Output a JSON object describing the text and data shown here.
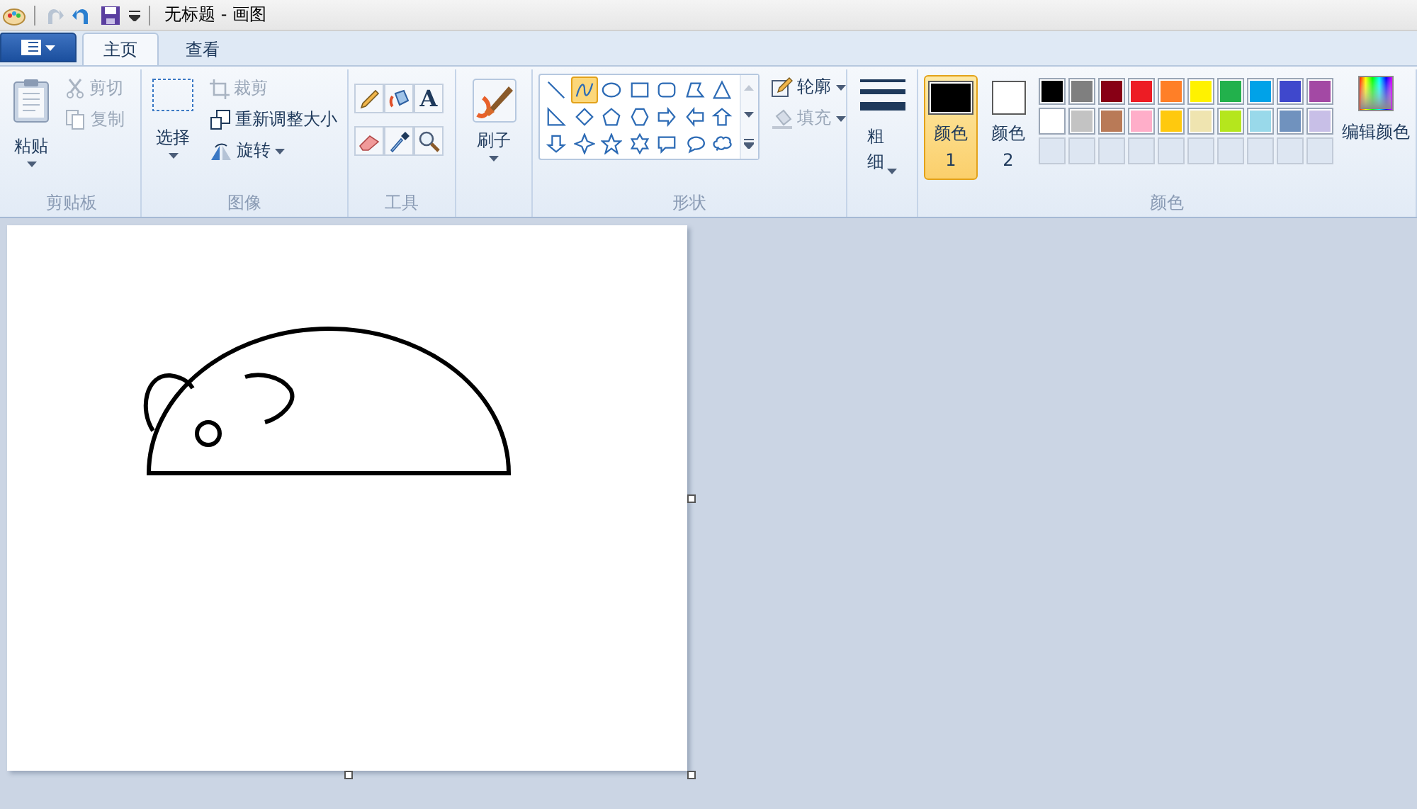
{
  "window": {
    "title": "无标题 - 画图"
  },
  "tabs": [
    {
      "label": "主页",
      "selected": true
    },
    {
      "label": "查看",
      "selected": false
    }
  ],
  "clipboard": {
    "title": "剪贴板",
    "paste": "粘贴",
    "items": [
      {
        "kind": "cut",
        "label": "剪切",
        "disabled": true
      },
      {
        "kind": "copy",
        "label": "复制",
        "disabled": true
      }
    ]
  },
  "image": {
    "title": "图像",
    "select": "选择",
    "items": [
      {
        "kind": "crop",
        "label": "裁剪",
        "disabled": true
      },
      {
        "kind": "resize",
        "label": "重新调整大小",
        "disabled": false
      },
      {
        "kind": "rotate",
        "label": "旋转",
        "disabled": false
      }
    ]
  },
  "tools": {
    "title": "工具",
    "text_tool": "A"
  },
  "brushes": {
    "label": "刷子"
  },
  "shapes": {
    "title": "形状",
    "outline": {
      "label": "轮廓",
      "disabled": false
    },
    "fill": {
      "label": "填充",
      "disabled": true
    },
    "items": [
      {
        "kind": "line",
        "selected": false
      },
      {
        "kind": "curve",
        "selected": true
      },
      {
        "kind": "oval",
        "selected": false
      },
      {
        "kind": "rect",
        "selected": false
      },
      {
        "kind": "roundrect",
        "selected": false
      },
      {
        "kind": "polygon",
        "selected": false
      },
      {
        "kind": "triangle",
        "selected": false
      },
      {
        "kind": "right-triangle",
        "selected": false
      },
      {
        "kind": "diamond",
        "selected": false
      },
      {
        "kind": "pentagon",
        "selected": false
      },
      {
        "kind": "hexagon",
        "selected": false
      },
      {
        "kind": "arrow-right",
        "selected": false
      },
      {
        "kind": "arrow-left",
        "selected": false
      },
      {
        "kind": "arrow-up",
        "selected": false
      },
      {
        "kind": "arrow-down",
        "selected": false
      },
      {
        "kind": "star4",
        "selected": false
      },
      {
        "kind": "star5",
        "selected": false
      },
      {
        "kind": "star6",
        "selected": false
      },
      {
        "kind": "callout-rect",
        "selected": false
      },
      {
        "kind": "callout-oval",
        "selected": false
      },
      {
        "kind": "callout-cloud",
        "selected": false
      }
    ]
  },
  "size": {
    "label": "粗细"
  },
  "colors": {
    "title": "颜色",
    "edit": "编辑颜色",
    "color1": {
      "label": "颜色 1",
      "color": "#000000",
      "selected": true
    },
    "color2": {
      "label": "颜色 2",
      "color": "#ffffff",
      "selected": false
    },
    "palette": [
      {
        "color": "#000000"
      },
      {
        "color": "#7f7f7f"
      },
      {
        "color": "#880015"
      },
      {
        "color": "#ed1c24"
      },
      {
        "color": "#ff7f27"
      },
      {
        "color": "#fff200"
      },
      {
        "color": "#22b14c"
      },
      {
        "color": "#00a2e8"
      },
      {
        "color": "#3f48cc"
      },
      {
        "color": "#a349a4"
      },
      {
        "color": "#ffffff"
      },
      {
        "color": "#c3c3c3"
      },
      {
        "color": "#b97a57"
      },
      {
        "color": "#ffaec9"
      },
      {
        "color": "#ffc90e"
      },
      {
        "color": "#efe4b0"
      },
      {
        "color": "#b5e61d"
      },
      {
        "color": "#99d9ea"
      },
      {
        "color": "#7092be"
      },
      {
        "color": "#c8bfe7"
      }
    ]
  }
}
